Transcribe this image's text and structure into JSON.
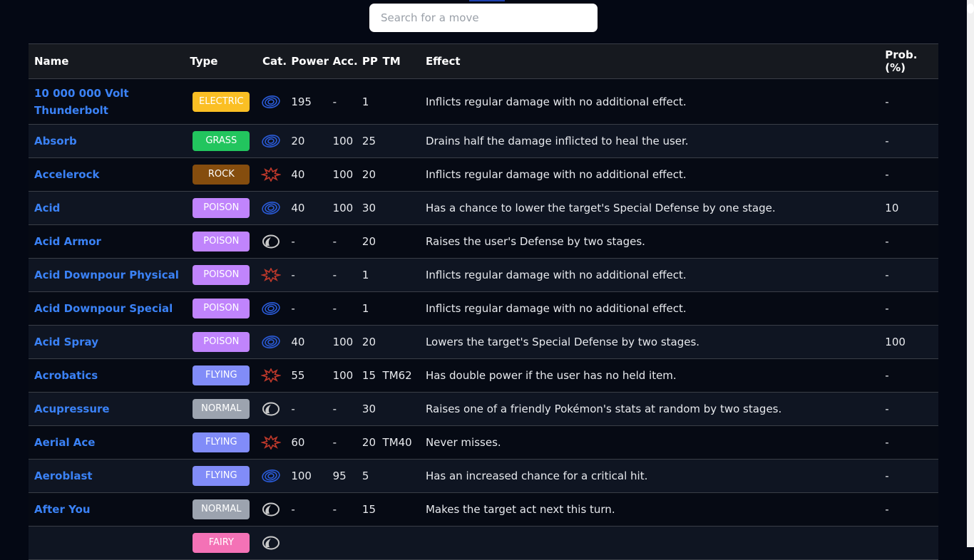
{
  "search": {
    "placeholder": "Search for a move",
    "value": ""
  },
  "colors": {
    "ELECTRIC": "#fbbf24",
    "GRASS": "#22c55e",
    "ROCK": "#854d0e",
    "POISON": "#c084fc",
    "FLYING": "#818cf8",
    "NORMAL": "#9ca3af",
    "FAIRY": "#f472b6",
    "link": "#3b82f6"
  },
  "category_icons": {
    "special": "special-category-icon",
    "physical": "physical-category-icon",
    "status": "status-category-icon"
  },
  "table": {
    "headers": [
      "Name",
      "Type",
      "Cat.",
      "Power",
      "Acc.",
      "PP",
      "TM",
      "Effect",
      "Prob. (%)"
    ],
    "rows": [
      {
        "name": "10 000 000 Volt Thunderbolt",
        "type": "ELECTRIC",
        "cat": "special",
        "power": "195",
        "acc": "-",
        "pp": "1",
        "tm": "",
        "effect": "Inflicts regular damage with no additional effect.",
        "prob": "-"
      },
      {
        "name": "Absorb",
        "type": "GRASS",
        "cat": "special",
        "power": "20",
        "acc": "100",
        "pp": "25",
        "tm": "",
        "effect": "Drains half the damage inflicted to heal the user.",
        "prob": "-"
      },
      {
        "name": "Accelerock",
        "type": "ROCK",
        "cat": "physical",
        "power": "40",
        "acc": "100",
        "pp": "20",
        "tm": "",
        "effect": "Inflicts regular damage with no additional effect.",
        "prob": "-"
      },
      {
        "name": "Acid",
        "type": "POISON",
        "cat": "special",
        "power": "40",
        "acc": "100",
        "pp": "30",
        "tm": "",
        "effect": "Has a chance to lower the target's Special Defense by one stage.",
        "prob": "10"
      },
      {
        "name": "Acid Armor",
        "type": "POISON",
        "cat": "status",
        "power": "-",
        "acc": "-",
        "pp": "20",
        "tm": "",
        "effect": "Raises the user's Defense by two stages.",
        "prob": "-"
      },
      {
        "name": "Acid Downpour Physical",
        "type": "POISON",
        "cat": "physical",
        "power": "-",
        "acc": "-",
        "pp": "1",
        "tm": "",
        "effect": "Inflicts regular damage with no additional effect.",
        "prob": "-"
      },
      {
        "name": "Acid Downpour Special",
        "type": "POISON",
        "cat": "special",
        "power": "-",
        "acc": "-",
        "pp": "1",
        "tm": "",
        "effect": "Inflicts regular damage with no additional effect.",
        "prob": "-"
      },
      {
        "name": "Acid Spray",
        "type": "POISON",
        "cat": "special",
        "power": "40",
        "acc": "100",
        "pp": "20",
        "tm": "",
        "effect": "Lowers the target's Special Defense by two stages.",
        "prob": "100"
      },
      {
        "name": "Acrobatics",
        "type": "FLYING",
        "cat": "physical",
        "power": "55",
        "acc": "100",
        "pp": "15",
        "tm": "TM62",
        "effect": "Has double power if the user has no held item.",
        "prob": "-"
      },
      {
        "name": "Acupressure",
        "type": "NORMAL",
        "cat": "status",
        "power": "-",
        "acc": "-",
        "pp": "30",
        "tm": "",
        "effect": "Raises one of a friendly Pokémon's stats at random by two stages.",
        "prob": "-"
      },
      {
        "name": "Aerial Ace",
        "type": "FLYING",
        "cat": "physical",
        "power": "60",
        "acc": "-",
        "pp": "20",
        "tm": "TM40",
        "effect": "Never misses.",
        "prob": "-"
      },
      {
        "name": "Aeroblast",
        "type": "FLYING",
        "cat": "special",
        "power": "100",
        "acc": "95",
        "pp": "5",
        "tm": "",
        "effect": "Has an increased chance for a critical hit.",
        "prob": "-"
      },
      {
        "name": "After You",
        "type": "NORMAL",
        "cat": "status",
        "power": "-",
        "acc": "-",
        "pp": "15",
        "tm": "",
        "effect": "Makes the target act next this turn.",
        "prob": "-"
      },
      {
        "name": "",
        "type": "FAIRY",
        "cat": "status",
        "power": "",
        "acc": "",
        "pp": "",
        "tm": "",
        "effect": "",
        "prob": ""
      }
    ]
  }
}
